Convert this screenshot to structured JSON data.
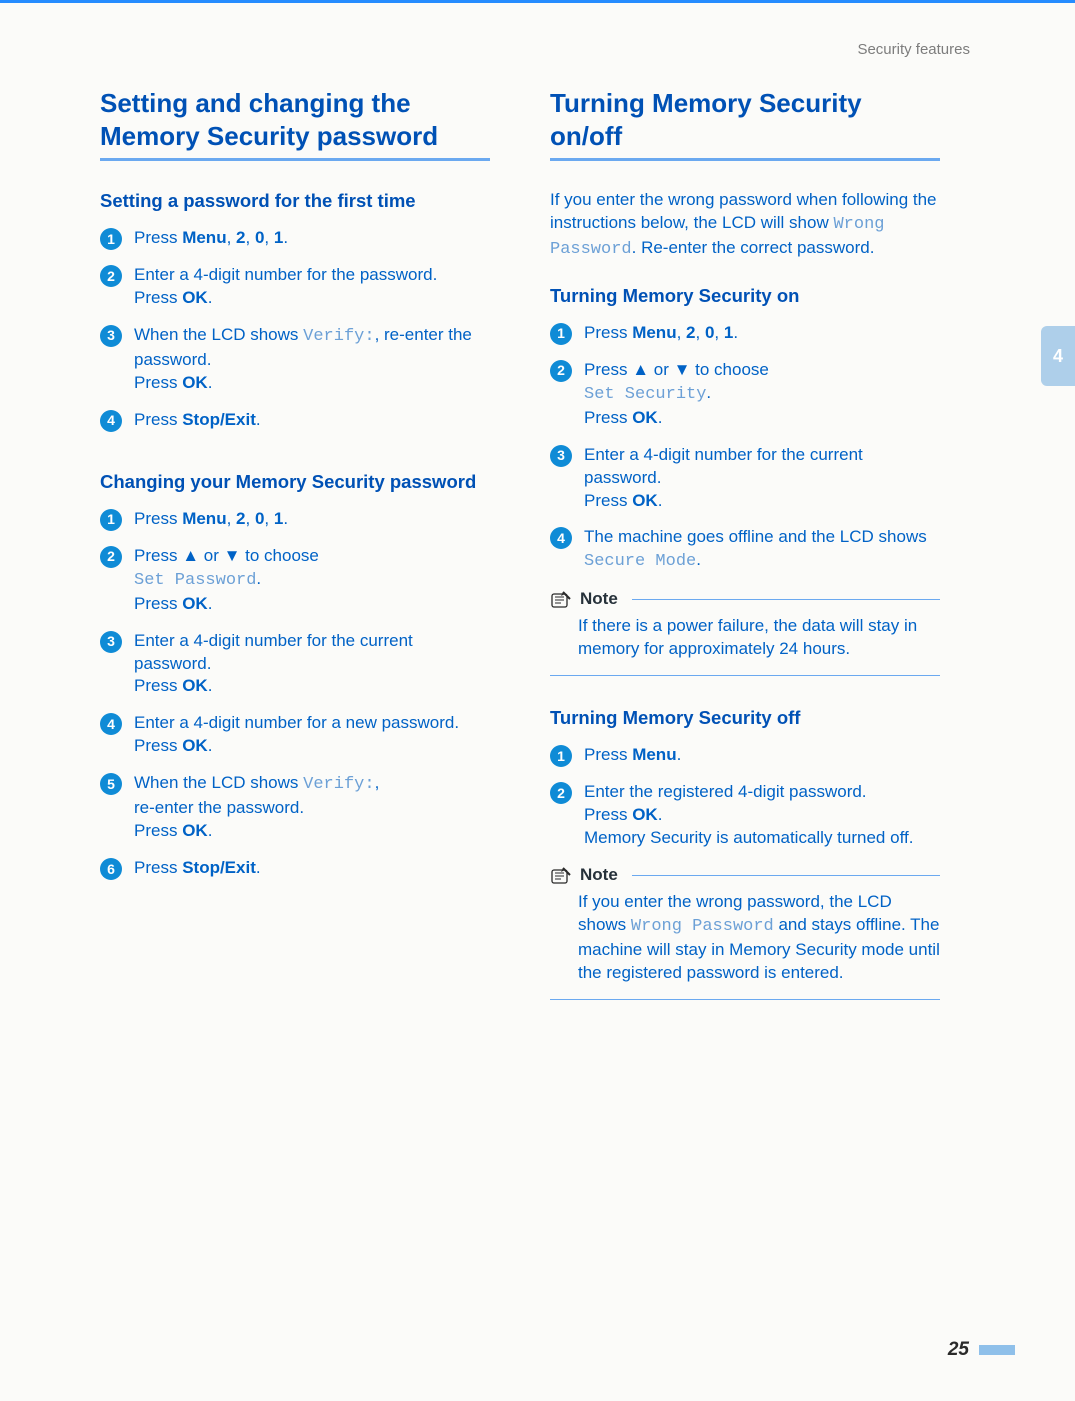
{
  "header": {
    "running_head": "Security features",
    "chapter_tab": "4",
    "page_number": "25"
  },
  "left": {
    "h1": "Setting and changing the Memory Security password",
    "sub1": "Setting a password for the first time",
    "s1_steps": [
      {
        "parts": [
          {
            "t": "Press "
          },
          {
            "t": "Menu",
            "b": true
          },
          {
            "t": ", "
          },
          {
            "t": "2",
            "b": true
          },
          {
            "t": ", "
          },
          {
            "t": "0",
            "b": true
          },
          {
            "t": ", "
          },
          {
            "t": "1",
            "b": true
          },
          {
            "t": "."
          }
        ]
      },
      {
        "parts": [
          {
            "t": "Enter a 4-digit number for the password."
          },
          {
            "br": true
          },
          {
            "t": "Press "
          },
          {
            "t": "OK",
            "b": true
          },
          {
            "t": "."
          }
        ]
      },
      {
        "parts": [
          {
            "t": "When the LCD shows "
          },
          {
            "t": "Verify:",
            "mono": true
          },
          {
            "t": ", re-enter the password."
          },
          {
            "br": true
          },
          {
            "t": "Press "
          },
          {
            "t": "OK",
            "b": true
          },
          {
            "t": "."
          }
        ]
      },
      {
        "parts": [
          {
            "t": "Press "
          },
          {
            "t": "Stop/Exit",
            "b": true
          },
          {
            "t": "."
          }
        ]
      }
    ],
    "sub2": "Changing your Memory Security password",
    "s2_steps": [
      {
        "parts": [
          {
            "t": "Press "
          },
          {
            "t": "Menu",
            "b": true
          },
          {
            "t": ", "
          },
          {
            "t": "2",
            "b": true
          },
          {
            "t": ", "
          },
          {
            "t": "0",
            "b": true
          },
          {
            "t": ", "
          },
          {
            "t": "1",
            "b": true
          },
          {
            "t": "."
          }
        ]
      },
      {
        "parts": [
          {
            "t": "Press "
          },
          {
            "t": "▲",
            "arrow": true
          },
          {
            "t": " or "
          },
          {
            "t": "▼",
            "arrow": true
          },
          {
            "t": " to choose"
          },
          {
            "br": true
          },
          {
            "t": "Set Password",
            "mono": true
          },
          {
            "t": "."
          },
          {
            "br": true
          },
          {
            "t": "Press "
          },
          {
            "t": "OK",
            "b": true
          },
          {
            "t": "."
          }
        ]
      },
      {
        "parts": [
          {
            "t": "Enter a 4-digit number for the current password."
          },
          {
            "br": true
          },
          {
            "t": "Press "
          },
          {
            "t": "OK",
            "b": true
          },
          {
            "t": "."
          }
        ]
      },
      {
        "parts": [
          {
            "t": "Enter a 4-digit number for a new password."
          },
          {
            "br": true
          },
          {
            "t": "Press "
          },
          {
            "t": "OK",
            "b": true
          },
          {
            "t": "."
          }
        ]
      },
      {
        "parts": [
          {
            "t": "When the LCD shows "
          },
          {
            "t": "Verify:",
            "mono": true
          },
          {
            "t": ","
          },
          {
            "br": true
          },
          {
            "t": "re-enter the password."
          },
          {
            "br": true
          },
          {
            "t": "Press "
          },
          {
            "t": "OK",
            "b": true
          },
          {
            "t": "."
          }
        ]
      },
      {
        "parts": [
          {
            "t": "Press "
          },
          {
            "t": "Stop/Exit",
            "b": true
          },
          {
            "t": "."
          }
        ]
      }
    ]
  },
  "right": {
    "h1": "Turning Memory Security on/off",
    "intro": [
      {
        "t": "If you enter the wrong password when following the instructions below, the LCD will show "
      },
      {
        "t": "Wrong Password",
        "mono": true
      },
      {
        "t": ". Re-enter the correct password."
      }
    ],
    "sub1": "Turning Memory Security on",
    "on_steps": [
      {
        "parts": [
          {
            "t": "Press "
          },
          {
            "t": "Menu",
            "b": true
          },
          {
            "t": ", "
          },
          {
            "t": "2",
            "b": true
          },
          {
            "t": ", "
          },
          {
            "t": "0",
            "b": true
          },
          {
            "t": ", "
          },
          {
            "t": "1",
            "b": true
          },
          {
            "t": "."
          }
        ]
      },
      {
        "parts": [
          {
            "t": "Press "
          },
          {
            "t": "▲",
            "arrow": true
          },
          {
            "t": " or "
          },
          {
            "t": "▼",
            "arrow": true
          },
          {
            "t": " to choose"
          },
          {
            "br": true
          },
          {
            "t": "Set Security",
            "mono": true
          },
          {
            "t": "."
          },
          {
            "br": true
          },
          {
            "t": "Press "
          },
          {
            "t": "OK",
            "b": true
          },
          {
            "t": "."
          }
        ]
      },
      {
        "parts": [
          {
            "t": "Enter a 4-digit number for the current password."
          },
          {
            "br": true
          },
          {
            "t": "Press "
          },
          {
            "t": "OK",
            "b": true
          },
          {
            "t": "."
          }
        ]
      },
      {
        "parts": [
          {
            "t": "The machine goes offline and the LCD shows "
          },
          {
            "t": "Secure Mode",
            "mono": true
          },
          {
            "t": "."
          }
        ]
      }
    ],
    "note1": {
      "label": "Note",
      "body": [
        {
          "t": "If there is a power failure, the data will stay in memory for approximately 24 hours."
        }
      ]
    },
    "sub2": "Turning Memory Security off",
    "off_steps": [
      {
        "parts": [
          {
            "t": "Press "
          },
          {
            "t": "Menu",
            "b": true
          },
          {
            "t": "."
          }
        ]
      },
      {
        "parts": [
          {
            "t": "Enter the registered 4-digit password."
          },
          {
            "br": true
          },
          {
            "t": "Press "
          },
          {
            "t": "OK",
            "b": true
          },
          {
            "t": "."
          },
          {
            "br": true
          },
          {
            "t": "Memory Security is automatically turned off."
          }
        ]
      }
    ],
    "note2": {
      "label": "Note",
      "body": [
        {
          "t": "If you enter the wrong password, the LCD shows "
        },
        {
          "t": "Wrong Password",
          "mono": true
        },
        {
          "t": " and stays offline. The machine will stay in Memory Security mode until the registered password is entered."
        }
      ]
    }
  }
}
